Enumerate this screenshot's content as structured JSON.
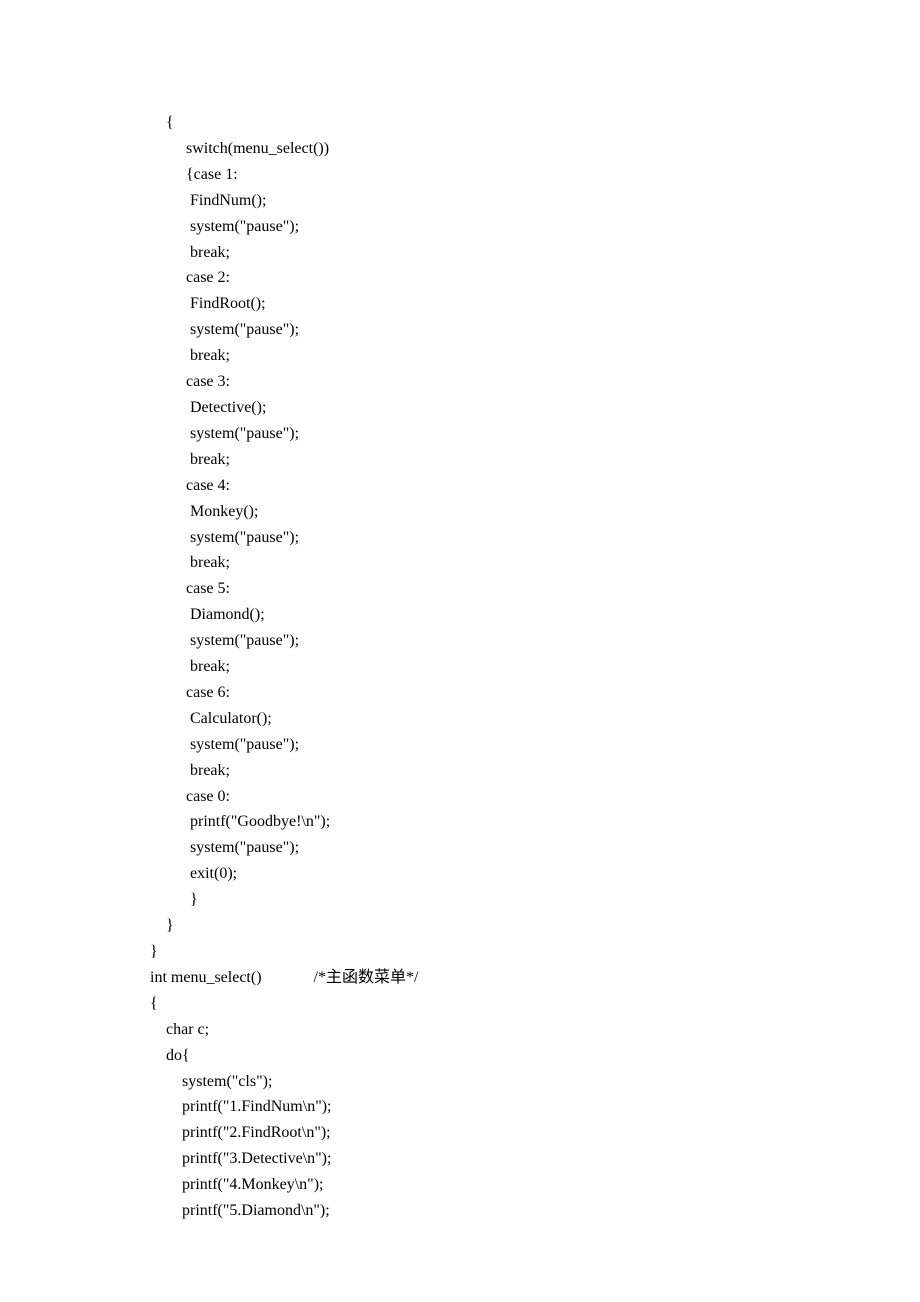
{
  "code": {
    "lines": [
      "{",
      "     switch(menu_select())",
      "     {case 1:",
      "      FindNum();",
      "      system(\"pause\");",
      "      break;",
      "     case 2:",
      "      FindRoot();",
      "      system(\"pause\");",
      "      break;",
      "     case 3:",
      "      Detective();",
      "      system(\"pause\");",
      "      break;",
      "     case 4:",
      "      Monkey();",
      "      system(\"pause\");",
      "      break;",
      "     case 5:",
      "      Diamond();",
      "      system(\"pause\");",
      "      break;",
      "     case 6:",
      "      Calculator();",
      "      system(\"pause\");",
      "      break;",
      "     case 0:",
      "      printf(\"Goodbye!\\n\");",
      "      system(\"pause\");",
      "      exit(0);",
      "      }",
      "}"
    ],
    "close_brace": "}",
    "blank": "",
    "func_decl_prefix": "int menu_select()             /*",
    "func_decl_comment": "主函数菜单",
    "func_decl_suffix": "*/",
    "open_brace": "{",
    "body": [
      "    char c;",
      "    do{",
      "        system(\"cls\");",
      "        printf(\"1.FindNum\\n\");",
      "        printf(\"2.FindRoot\\n\");",
      "        printf(\"3.Detective\\n\");",
      "        printf(\"4.Monkey\\n\");",
      "        printf(\"5.Diamond\\n\");"
    ]
  }
}
